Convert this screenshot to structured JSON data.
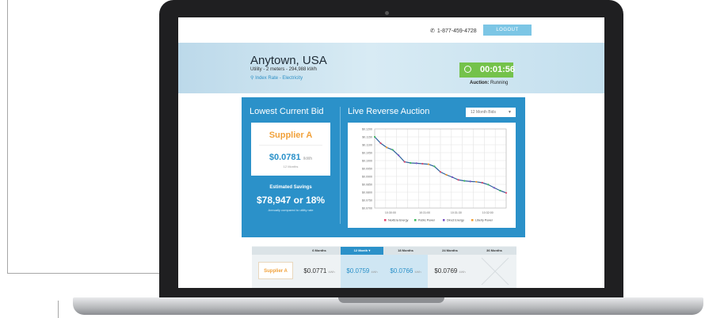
{
  "header": {
    "phone": "1-877-459-4728",
    "logout_label": "LOGOUT"
  },
  "location": {
    "city": "Anytown, USA",
    "meters": "Utility - 2 meters - 294,988 kWh",
    "rate": "Index Rate - Electricity"
  },
  "timer": {
    "time": "00:01:56",
    "status_label": "Auction:",
    "status_value": "Running"
  },
  "lowest_bid": {
    "title": "Lowest Current Bid",
    "supplier": "Supplier A",
    "value": "$0.0781",
    "unit": "/kWh",
    "term": "12 Months",
    "savings_label": "Estimated Savings",
    "savings_value": "$78,947 or 18%",
    "savings_note": "Annually compared to utility rate"
  },
  "auction": {
    "title": "Live Reverse Auction",
    "filter": "12 Month Bids"
  },
  "chart_data": {
    "type": "line",
    "title": "",
    "xlabel": "",
    "ylabel": "",
    "x_ticks": [
      "10:30:00",
      "10:31:00",
      "10:31:30",
      "10:32:00"
    ],
    "y_ticks": [
      "$0.1200",
      "$0.1150",
      "$0.1100",
      "$0.1050",
      "$0.1000",
      "$0.0950",
      "$0.0900",
      "$0.0850",
      "$0.0800",
      "$0.0750",
      "$0.0700"
    ],
    "ylim": [
      0.07,
      0.12
    ],
    "grid": true,
    "legend_position": "bottom",
    "x": [
      0,
      0.5,
      1,
      1.5,
      2,
      2.5,
      3,
      3.5,
      4,
      4.5,
      5,
      5.5,
      6,
      6.5,
      7,
      7.5,
      8,
      8.5,
      9,
      9.5,
      10,
      10.5,
      11
    ],
    "values": [
      0.115,
      0.111,
      0.1083,
      0.1068,
      0.1033,
      0.0992,
      0.0985,
      0.0983,
      0.098,
      0.0977,
      0.0963,
      0.0928,
      0.091,
      0.0895,
      0.0878,
      0.0872,
      0.0868,
      0.0866,
      0.086,
      0.0848,
      0.0828,
      0.081,
      0.0796
    ],
    "series": [
      {
        "name": "NextEra Energy",
        "color": "#e0456d"
      },
      {
        "name": "Public Power",
        "color": "#3dbb5b"
      },
      {
        "name": "Direct Energy",
        "color": "#7a4fc3"
      },
      {
        "name": "Liberty Power",
        "color": "#f29b2b"
      }
    ]
  },
  "bids_table": {
    "headers": [
      "6 Months",
      "12 Month",
      "18 Months",
      "24 Months",
      "36 Months"
    ],
    "supplier": "Supplier A",
    "unit": "kWh",
    "values": [
      "$0.0771",
      "$0.0759",
      "$0.0766",
      "$0.0769"
    ]
  },
  "colors": {
    "accent": "#2b91c9",
    "supplier": "#f1a13a",
    "timer": "#74c24b",
    "logout": "#7cc6e5"
  }
}
